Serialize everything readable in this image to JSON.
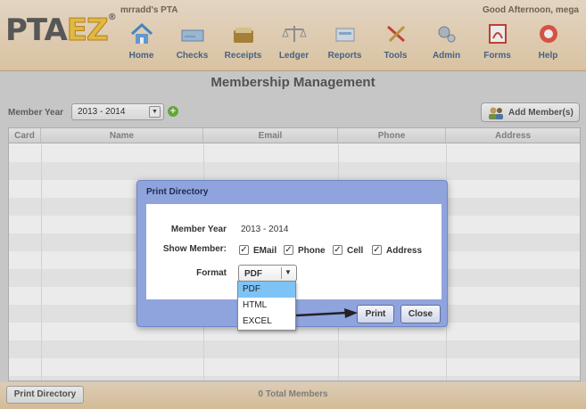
{
  "header": {
    "org_name": "mrradd's PTA",
    "greeting": "Good Afternoon, mega",
    "logo_pta": "PTA",
    "logo_ez": "EZ",
    "logo_reg": "®",
    "nav": [
      {
        "label": "Home",
        "icon": "home-icon"
      },
      {
        "label": "Checks",
        "icon": "checks-icon"
      },
      {
        "label": "Receipts",
        "icon": "receipts-icon"
      },
      {
        "label": "Ledger",
        "icon": "ledger-icon"
      },
      {
        "label": "Reports",
        "icon": "reports-icon"
      },
      {
        "label": "Tools",
        "icon": "tools-icon"
      },
      {
        "label": "Admin",
        "icon": "admin-icon"
      },
      {
        "label": "Forms",
        "icon": "forms-icon"
      },
      {
        "label": "Help",
        "icon": "help-icon"
      }
    ]
  },
  "page_title": "Membership Management",
  "toolbar": {
    "member_year_label": "Member Year",
    "member_year_value": "2013 - 2014",
    "add_member_label": "Add Member(s)"
  },
  "table": {
    "columns": [
      "Card",
      "Name",
      "Email",
      "Phone",
      "Address"
    ]
  },
  "footer": {
    "print_directory_label": "Print Directory",
    "total_members": "0 Total Members"
  },
  "dialog": {
    "title": "Print Directory",
    "member_year_label": "Member Year",
    "member_year_value": "2013 - 2014",
    "show_member_label": "Show Member:",
    "options": [
      {
        "label": "EMail",
        "checked": true
      },
      {
        "label": "Phone",
        "checked": true
      },
      {
        "label": "Cell",
        "checked": true
      },
      {
        "label": "Address",
        "checked": true
      }
    ],
    "format_label": "Format",
    "format_value": "PDF",
    "format_options": [
      "PDF",
      "HTML",
      "EXCEL"
    ],
    "print_label": "Print",
    "close_label": "Close"
  },
  "colors": {
    "header_bg": "#ecd3b0",
    "dialog_bg": "#8fa3dd",
    "selected_option": "#7ec3f6"
  }
}
